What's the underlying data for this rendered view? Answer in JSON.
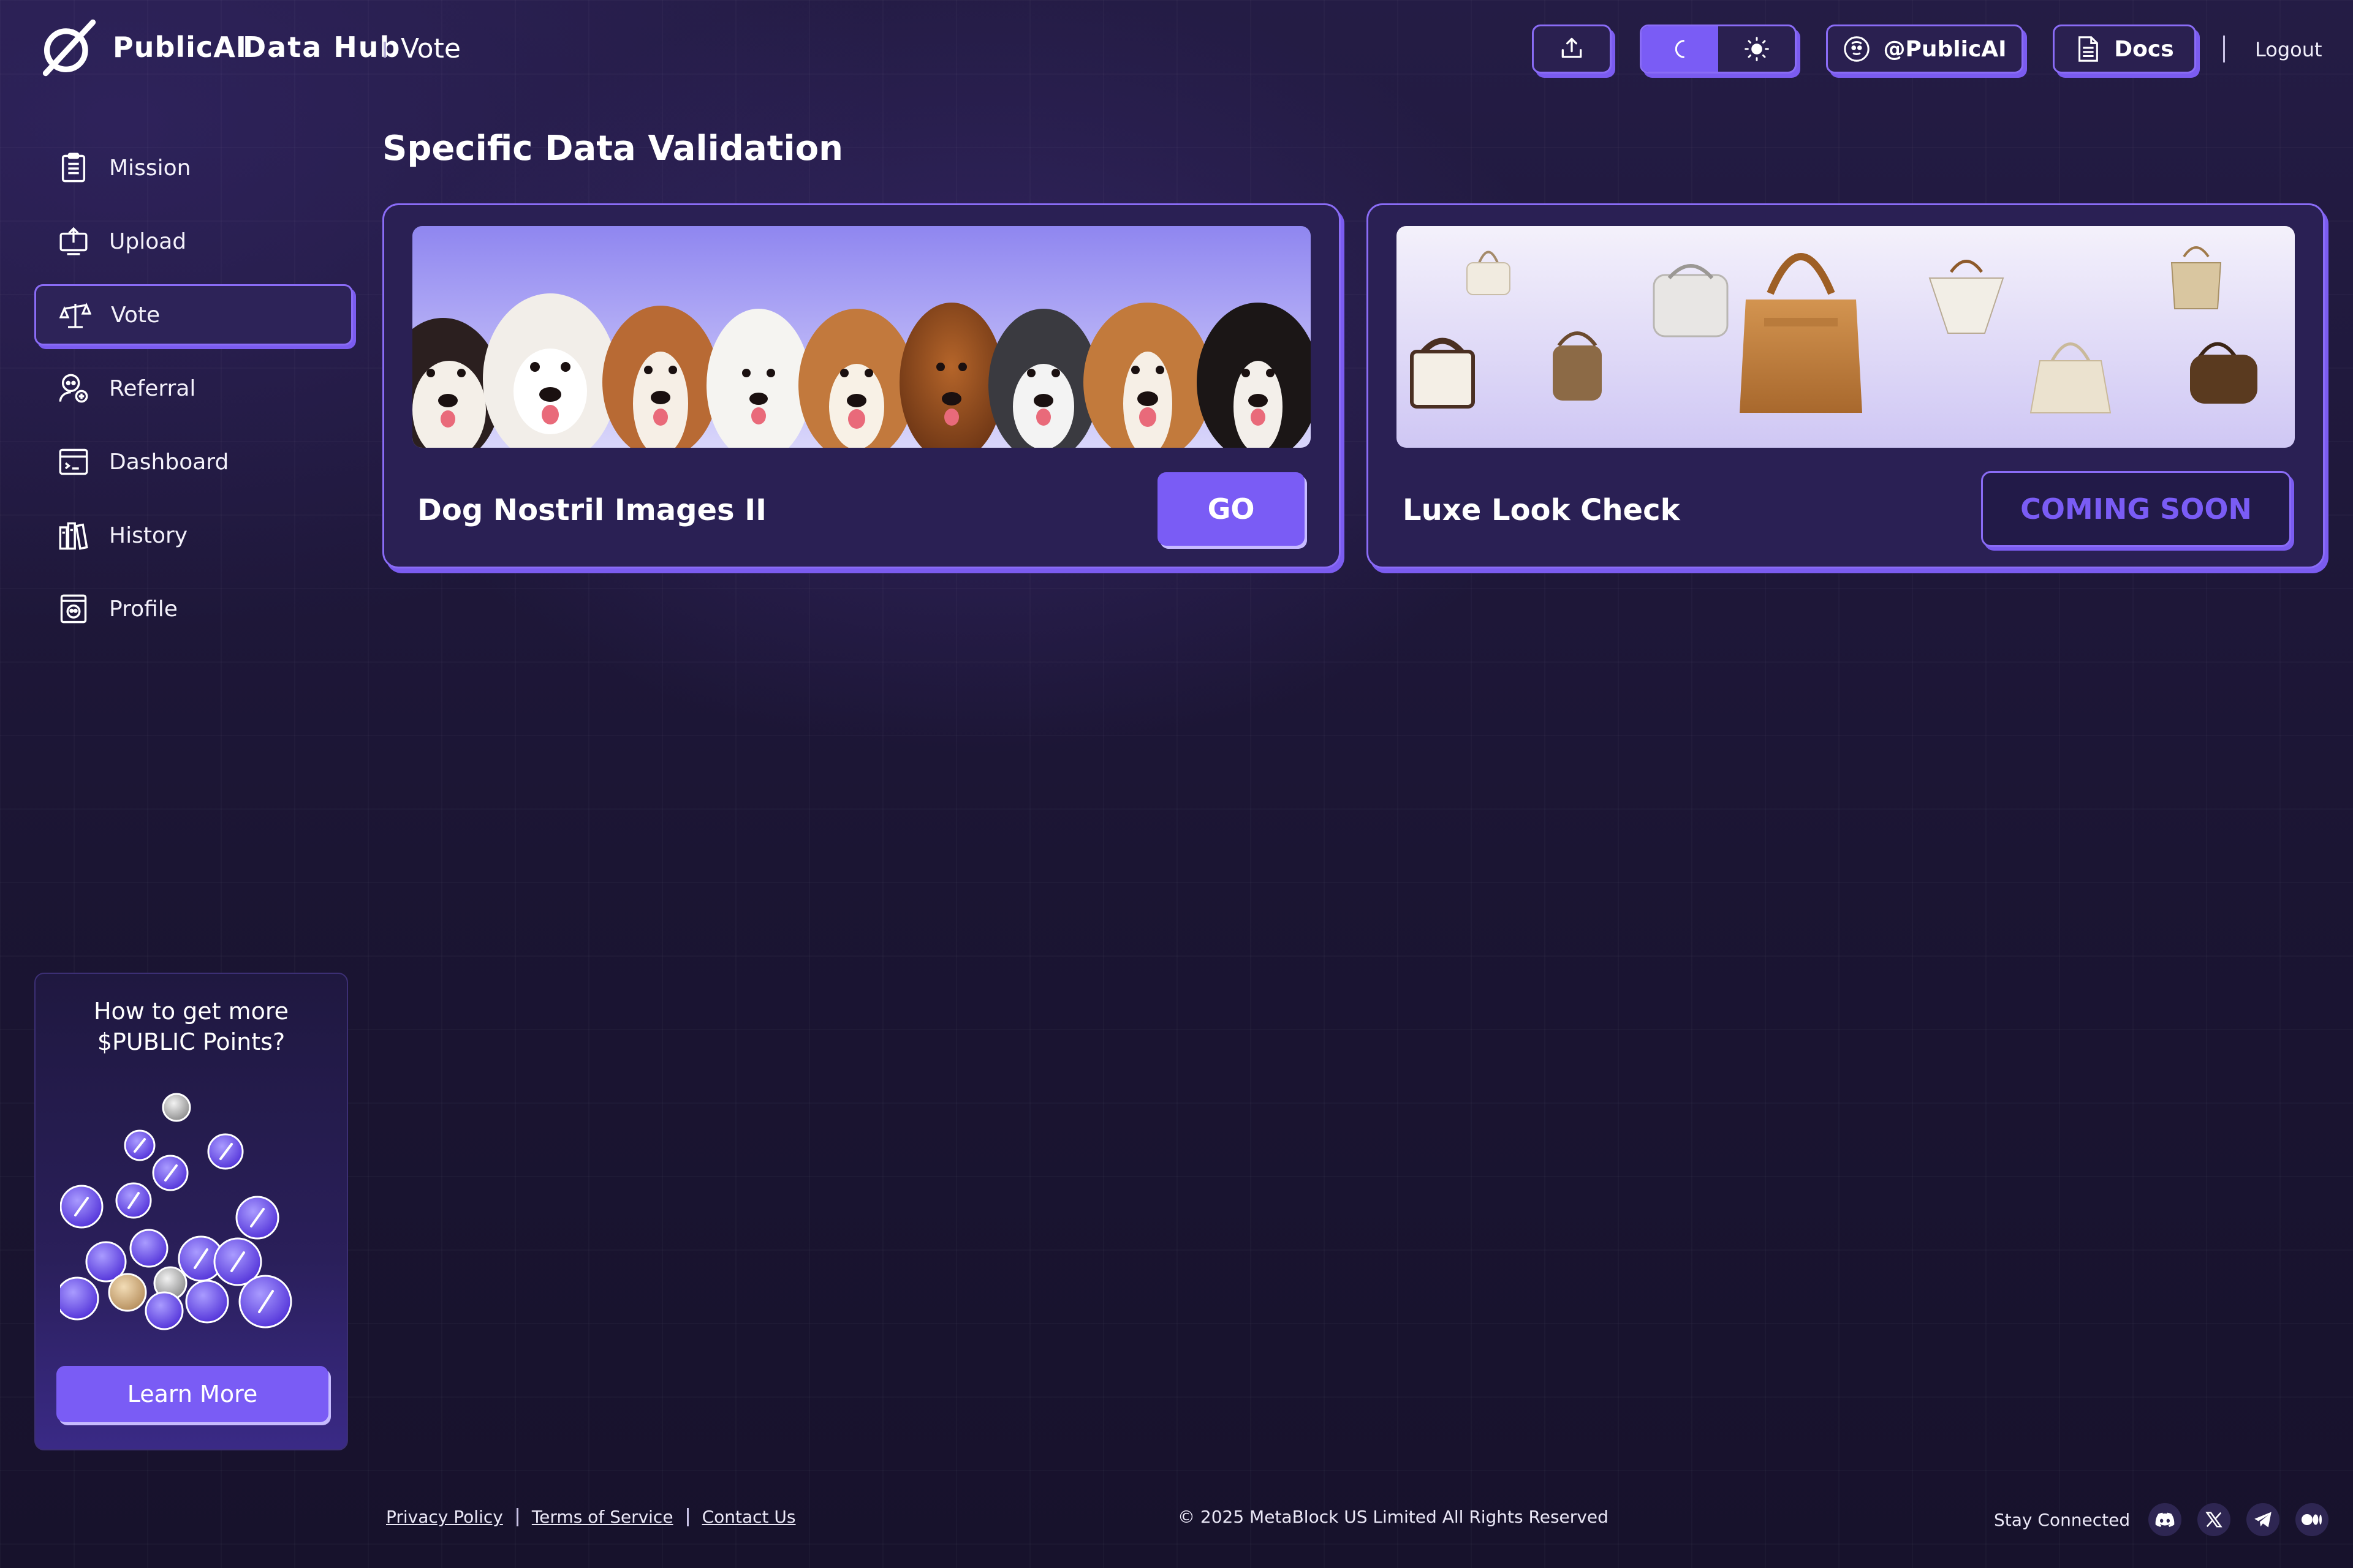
{
  "header": {
    "brand": "PublicAI",
    "hub": "Data Hub",
    "breadcrumb": "Vote",
    "twitter_label": "@PublicAI",
    "docs_label": "Docs",
    "logout_label": "Logout"
  },
  "sidebar": {
    "items": [
      {
        "label": "Mission",
        "icon": "clipboard-icon"
      },
      {
        "label": "Upload",
        "icon": "upload-icon"
      },
      {
        "label": "Vote",
        "icon": "scale-icon",
        "active": true
      },
      {
        "label": "Referral",
        "icon": "referral-icon"
      },
      {
        "label": "Dashboard",
        "icon": "dashboard-icon"
      },
      {
        "label": "History",
        "icon": "history-icon"
      },
      {
        "label": "Profile",
        "icon": "profile-icon"
      }
    ]
  },
  "promo": {
    "title": "How to get more $PUBLIC Points?",
    "button": "Learn More"
  },
  "main": {
    "title": "Specific Data Validation",
    "cards": [
      {
        "title": "Dog Nostril Images II",
        "action": "GO"
      },
      {
        "title": "Luxe Look Check",
        "action": "COMING SOON"
      }
    ]
  },
  "footer": {
    "links": [
      "Privacy Policy",
      "Terms of Service",
      "Contact Us"
    ],
    "copyright": "© 2025 MetaBlock US Limited All Rights Reserved",
    "stay_connected": "Stay Connected",
    "social": [
      "discord-icon",
      "x-icon",
      "telegram-icon",
      "medium-icon"
    ]
  },
  "colors": {
    "accent": "#7a5cf5",
    "background": "#1c1633",
    "card": "#2a2054",
    "border": "#8a6cf6"
  }
}
